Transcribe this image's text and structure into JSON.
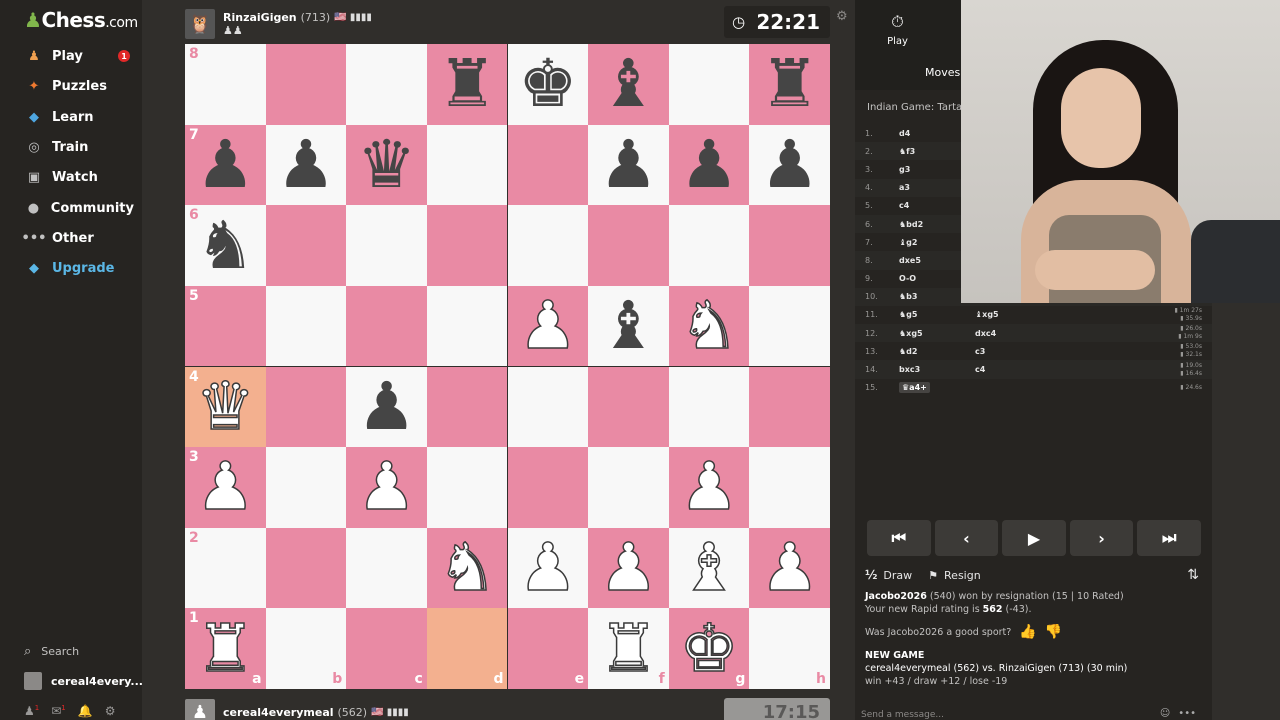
{
  "sidebar": {
    "logo": "Chess",
    "logo_suffix": ".com",
    "items": [
      {
        "label": "Play",
        "icon": "pawn-icon",
        "color": "#f0a050"
      },
      {
        "label": "Puzzles",
        "icon": "puzzle-icon",
        "color": "#f07a30"
      },
      {
        "label": "Learn",
        "icon": "graduation-cap-icon",
        "color": "#4ea6e0"
      },
      {
        "label": "Train",
        "icon": "target-icon",
        "color": "#c0c0c0"
      },
      {
        "label": "Watch",
        "icon": "tv-icon",
        "color": "#c0c0c0"
      },
      {
        "label": "Community",
        "icon": "people-icon",
        "color": "#c0c0c0"
      },
      {
        "label": "Other",
        "icon": "more-dots-icon",
        "color": "#c0c0c0"
      },
      {
        "label": "Upgrade",
        "icon": "diamond-icon",
        "color": "#5bb7e6"
      }
    ],
    "play_badge": "1",
    "search_label": "Search",
    "username": "cereal4every...",
    "bottom_badge_1": "1",
    "bottom_badge_2": "1"
  },
  "top_player": {
    "name": "RinzaiGigen",
    "rating": "(713)",
    "flag": "🇺🇸 ▮▮▮▮",
    "captured": "♟♟",
    "clock": "22:21"
  },
  "bottom_player": {
    "name": "cereal4everymeal",
    "rating": "(562)",
    "flag": "🇺🇸 ▮▮▮▮",
    "clock": "17:15"
  },
  "board": {
    "ranks": [
      "8",
      "7",
      "6",
      "5",
      "4",
      "3",
      "2",
      "1"
    ],
    "files": [
      "a",
      "b",
      "c",
      "d",
      "e",
      "f",
      "g",
      "h"
    ],
    "light_color": "#f8f8f8",
    "dark_color": "#e98aa4",
    "highlight_color": "#f3b08f",
    "highlights": [
      "a4",
      "d1"
    ],
    "position": {
      "d8": "br",
      "e8": "bk",
      "f8": "bb",
      "h8": "br",
      "a7": "bp",
      "b7": "bp",
      "c7": "bq",
      "f7": "bp",
      "g7": "bp",
      "h7": "bp",
      "a6": "bn",
      "e5": "wp",
      "f5": "bb",
      "g5": "wn",
      "a4": "wq",
      "c4": "bp",
      "a3": "wp",
      "c3": "wp",
      "g3": "wp",
      "d2": "wn",
      "e2": "wp",
      "f2": "wp",
      "g2": "wb",
      "h2": "wp",
      "a1": "wr",
      "f1": "wr",
      "g1": "wk"
    }
  },
  "panel": {
    "tab_play": "Play",
    "tab_moves": "Moves",
    "opening": "Indian Game: Tartakov",
    "moves": [
      {
        "n": "1.",
        "w": "d4",
        "b": "",
        "t": ""
      },
      {
        "n": "2.",
        "w": "♞f3",
        "b": "",
        "t": ""
      },
      {
        "n": "3.",
        "w": "g3",
        "b": "",
        "t": ""
      },
      {
        "n": "4.",
        "w": "a3",
        "b": "",
        "t": ""
      },
      {
        "n": "5.",
        "w": "c4",
        "b": "",
        "t": ""
      },
      {
        "n": "6.",
        "w": "♞bd2",
        "b": "",
        "t": ""
      },
      {
        "n": "7.",
        "w": "♝g2",
        "b": "",
        "t": ""
      },
      {
        "n": "8.",
        "w": "dxe5",
        "b": "",
        "t": ""
      },
      {
        "n": "9.",
        "w": "O-O",
        "b": "",
        "t": ""
      },
      {
        "n": "10.",
        "w": "♞b3",
        "b": "",
        "t": ""
      },
      {
        "n": "11.",
        "w": "♞g5",
        "b": "♝xg5",
        "t": "1m 27s\n35.9s"
      },
      {
        "n": "12.",
        "w": "♞xg5",
        "b": "dxc4",
        "t": "26.0s\n1m 9s"
      },
      {
        "n": "13.",
        "w": "♞d2",
        "b": "c3",
        "t": "53.0s\n32.1s"
      },
      {
        "n": "14.",
        "w": "bxc3",
        "b": "c4",
        "t": "19.0s\n16.4s"
      },
      {
        "n": "15.",
        "w": "♛a4+",
        "b": "",
        "t": "24.6s"
      }
    ],
    "nav_buttons": [
      "⏮",
      "‹",
      "▶",
      "›",
      "⏭"
    ],
    "draw_label": "Draw",
    "resign_label": "Resign",
    "result_line_1_name": "Jacobo2026",
    "result_line_1": "(540) won by resignation (15 | 10 Rated)",
    "result_line_2_prefix": "Your new Rapid rating is",
    "result_line_2_rating": "562",
    "result_line_2_suffix": "(-43).",
    "sport_question_prefix": "Was",
    "sport_question_name": "Jacobo2026",
    "sport_question_suffix": "a good sport?",
    "new_game_label": "NEW GAME",
    "new_game_players": "cereal4everymeal (562) vs. RinzaiGigen (713) (30 min)",
    "new_game_stakes": "win +43 / draw +12 / lose -19",
    "send_placeholder": "Send a message..."
  }
}
